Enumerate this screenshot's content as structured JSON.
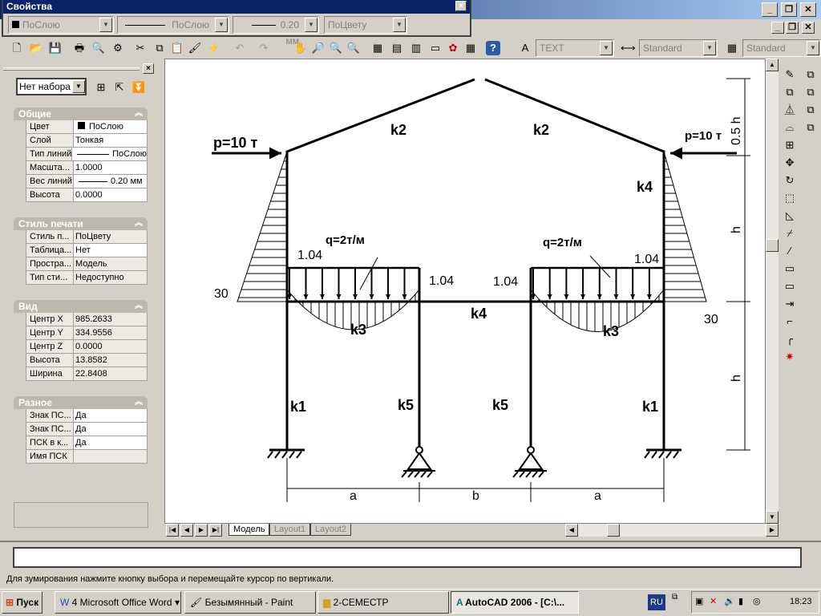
{
  "window": {
    "min": "_",
    "restore": "❐",
    "close": "✕"
  },
  "properties_toolbar": {
    "title": "Свойства",
    "close": "×",
    "color": "ПоСлою",
    "linetype": "ПоСлою",
    "lineweight": "0.20 мм",
    "plotstyle": "ПоЦвету"
  },
  "toolbar": {
    "text_style": "TEXT",
    "dim_style": "Standard",
    "table_style": "Standard",
    "help": "?"
  },
  "panel": {
    "close": "×",
    "selection": "Нет набора",
    "sections": [
      {
        "title": "Общие",
        "rows": [
          {
            "k": "Цвет",
            "v": "ПоСлою"
          },
          {
            "k": "Слой",
            "v": "Тонкая"
          },
          {
            "k": "Тип линий",
            "v": "ПоСлою"
          },
          {
            "k": "Масшта...",
            "v": "1.0000"
          },
          {
            "k": "Вес линий",
            "v": "0.20 мм"
          },
          {
            "k": "Высота",
            "v": "0.0000"
          }
        ]
      },
      {
        "title": "Стиль печати",
        "rows": [
          {
            "k": "Стиль п...",
            "v": "ПоЦвету"
          },
          {
            "k": "Таблица...",
            "v": "Нет"
          },
          {
            "k": "Простра...",
            "v": "Модель"
          },
          {
            "k": "Тип сти...",
            "v": "Недоступно"
          }
        ]
      },
      {
        "title": "Вид",
        "rows": [
          {
            "k": "Центр X",
            "v": "985.2633"
          },
          {
            "k": "Центр Y",
            "v": "334.9556"
          },
          {
            "k": "Центр Z",
            "v": "0.0000"
          },
          {
            "k": "Высота",
            "v": "13.8582"
          },
          {
            "k": "Ширина",
            "v": "22.8408"
          }
        ]
      },
      {
        "title": "Разное",
        "rows": [
          {
            "k": "Знак ПС...",
            "v": "Да"
          },
          {
            "k": "Знак ПС...",
            "v": "Да"
          },
          {
            "k": "ПСК в к...",
            "v": "Да"
          },
          {
            "k": "Имя ПСК",
            "v": ""
          }
        ]
      }
    ]
  },
  "drawing": {
    "k2": "k2",
    "k4": "k4",
    "k3": "k3",
    "k1": "k1",
    "k5": "k5",
    "p_left": "p=10 т",
    "p_right": "p=10 т",
    "q": "q=2т/м",
    "m104": "1.04",
    "m30": "30",
    "dim_a": "a",
    "dim_b": "b",
    "dim_h": "h",
    "dim_05h": "0.5 h"
  },
  "tabs": [
    "Модель",
    "Layout1",
    "Layout2"
  ],
  "status_text": "Для зумирования нажмите кнопку выбора и перемещайте курсор по вертикали.",
  "taskbar": {
    "start": "Пуск",
    "items": [
      "4 Microsoft Office Word",
      "Безымянный - Paint",
      "2-СЕМЕСТР",
      "AutoCAD 2006 - [C:\\..."
    ],
    "lang": "RU",
    "clock": "18:23"
  }
}
